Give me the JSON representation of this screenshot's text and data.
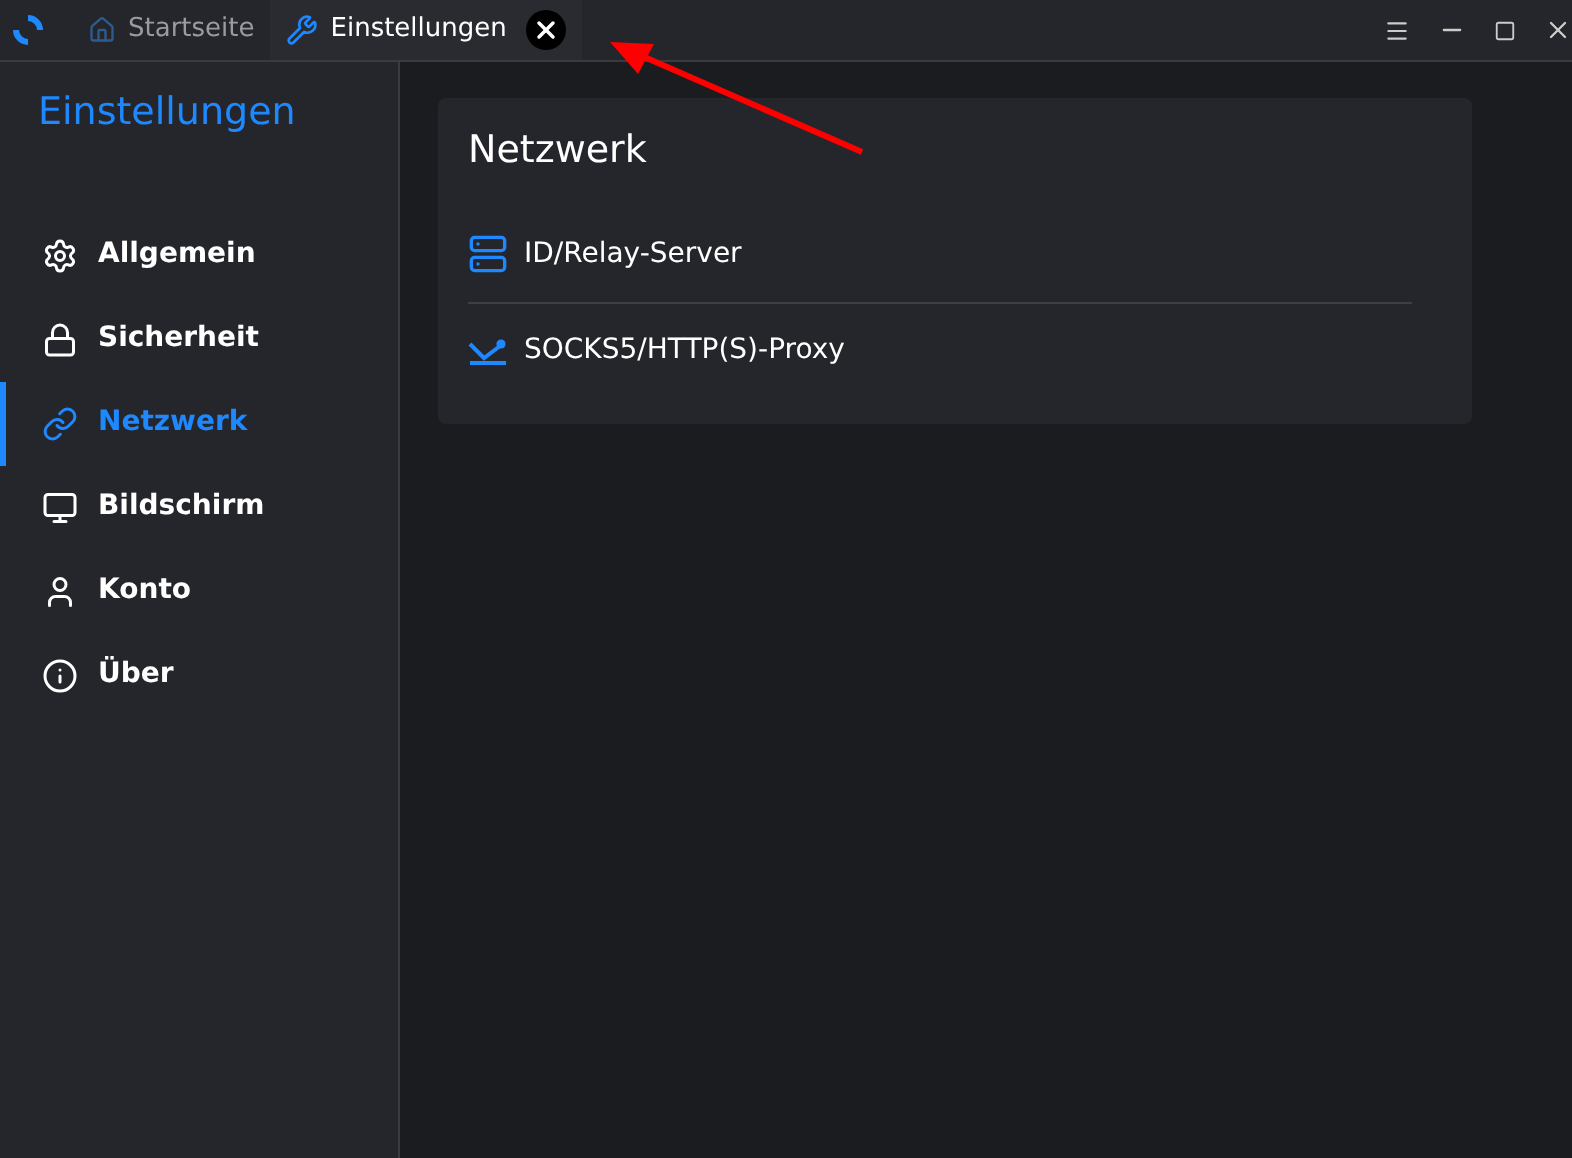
{
  "tabs": [
    {
      "label": "Startseite",
      "selected": false
    },
    {
      "label": "Einstellungen",
      "selected": true
    }
  ],
  "sidebar": {
    "title": "Einstellungen",
    "items": [
      {
        "label": "Allgemein",
        "selected": false
      },
      {
        "label": "Sicherheit",
        "selected": false
      },
      {
        "label": "Netzwerk",
        "selected": true
      },
      {
        "label": "Bildschirm",
        "selected": false
      },
      {
        "label": "Konto",
        "selected": false
      },
      {
        "label": "Über",
        "selected": false
      }
    ]
  },
  "card": {
    "title": "Netzwerk",
    "items": [
      {
        "label": "ID/Relay-Server"
      },
      {
        "label": "SOCKS5/HTTP(S)-Proxy"
      }
    ]
  }
}
